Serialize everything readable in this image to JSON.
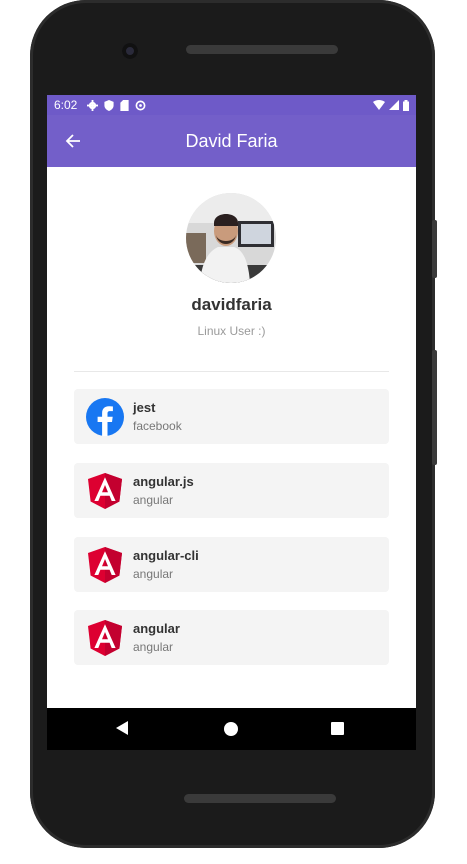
{
  "status_bar": {
    "time": "6:02"
  },
  "app_bar": {
    "title": "David Faria"
  },
  "profile": {
    "username": "davidfaria",
    "bio": "Linux User :)"
  },
  "repos": [
    {
      "name": "jest",
      "owner": "facebook",
      "icon": "facebook-logo-icon"
    },
    {
      "name": "angular.js",
      "owner": "angular",
      "icon": "angular-logo-icon"
    },
    {
      "name": "angular-cli",
      "owner": "angular",
      "icon": "angular-logo-icon"
    },
    {
      "name": "angular",
      "owner": "angular",
      "icon": "angular-logo-icon"
    }
  ],
  "colors": {
    "app_bar": "#735fc9",
    "status_bar": "#6e5ac8",
    "card_bg": "#f4f4f4",
    "facebook_blue": "#1877f2",
    "angular_red": "#dd0031"
  }
}
